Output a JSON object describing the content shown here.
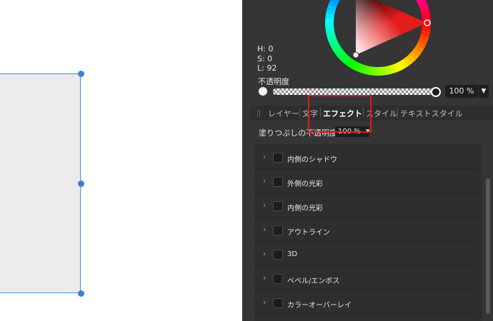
{
  "color": {
    "h_label": "H: 0",
    "s_label": "S: 0",
    "l_label": "L: 92",
    "opacity_label": "不透明度",
    "opacity_value": "100 %",
    "opacity_fraction": 1.0,
    "dropdown_glyph": "▼"
  },
  "tabs": [
    {
      "label": "レイヤー",
      "active": false
    },
    {
      "label": "文字",
      "active": false
    },
    {
      "label": "エフェクト",
      "active": true
    },
    {
      "label": "スタイル",
      "active": false
    },
    {
      "label": "テキストスタイル",
      "active": false
    }
  ],
  "effects_panel": {
    "fill_opacity_label": "塗りつぶしの不透明度:",
    "fill_opacity_value": "100 %",
    "dropdown_glyph": "▼",
    "chevron_glyph": "›",
    "items": [
      {
        "label": "内側のシャドウ",
        "checked": false
      },
      {
        "label": "外側の光彩",
        "checked": false
      },
      {
        "label": "内側の光彩",
        "checked": false
      },
      {
        "label": "アウトライン",
        "checked": false
      },
      {
        "label": "3D",
        "checked": false
      },
      {
        "label": "ベベル/エンボス",
        "checked": false
      },
      {
        "label": "カラーオーバーレイ",
        "checked": false
      }
    ]
  },
  "icons": {
    "chevron": "chevron-right-icon",
    "dropdown": "chevron-down-icon",
    "grip": "drag-grip-icon"
  },
  "colors": {
    "panel_bg": "#353535",
    "selection_blue": "#3f7fd6",
    "highlight_red": "#e01c1c",
    "shape_fill": "#ececec"
  }
}
